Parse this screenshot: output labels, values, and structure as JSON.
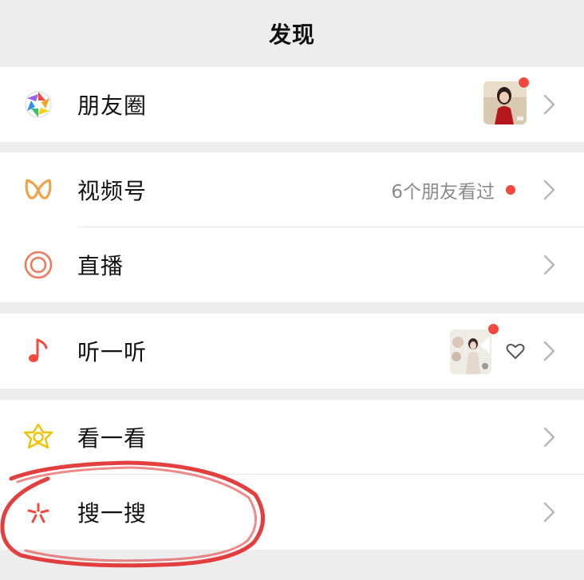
{
  "header": {
    "title": "发现"
  },
  "items": [
    {
      "key": "moments",
      "label": "朋友圈",
      "icon": "moments-aperture-icon",
      "has_thumbnail": true,
      "has_red_dot": true
    },
    {
      "key": "channels",
      "label": "视频号",
      "icon": "channels-butterfly-icon",
      "status": "6个朋友看过",
      "has_red_dot": true
    },
    {
      "key": "live",
      "label": "直播",
      "icon": "live-ring-icon"
    },
    {
      "key": "listen",
      "label": "听一听",
      "icon": "music-note-icon",
      "has_thumbnail": true,
      "has_red_dot": true,
      "has_heart": true
    },
    {
      "key": "top_stories",
      "label": "看一看",
      "icon": "top-stories-star-icon"
    },
    {
      "key": "search",
      "label": "搜一搜",
      "icon": "search-sparkle-icon",
      "annotated": true
    }
  ],
  "colors": {
    "background": "#ededed",
    "cell": "#ffffff",
    "red_dot": "#f2493f",
    "channels_icon": "#f0a24b",
    "live_icon": "#ef7a5b",
    "music_icon": "#f2493f",
    "top_stories_icon": "#f2c200",
    "search_icon": "#f2493f",
    "annotation_circle": "#e02a2a"
  }
}
